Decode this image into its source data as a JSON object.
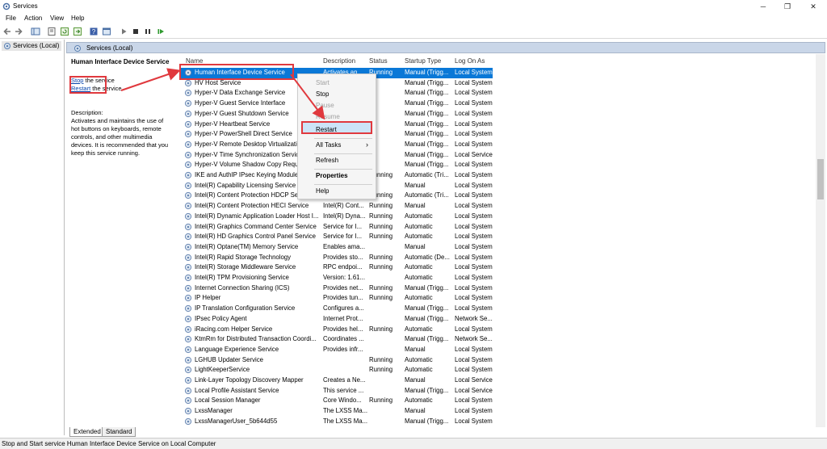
{
  "window": {
    "title": "Services",
    "minimize": "─",
    "maximize": "❐",
    "close": "✕"
  },
  "menu": [
    "File",
    "Action",
    "View",
    "Help"
  ],
  "tree": {
    "root": "Services (Local)"
  },
  "main_header": "Services (Local)",
  "description": {
    "service_name": "Human Interface Device Service",
    "stop_link": "Stop",
    "stop_suffix": " the service",
    "restart_link": "Restart",
    "restart_suffix": " the service",
    "label": "Description:",
    "lines": [
      "Activates and maintains the use of",
      "hot buttons on keyboards, remote",
      "controls, and other multimedia",
      "devices. It is recommended that you",
      "keep this service running."
    ]
  },
  "columns": {
    "name": "Name",
    "description": "Description",
    "status": "Status",
    "startup": "Startup Type",
    "logon": "Log On As"
  },
  "services": [
    {
      "name": "Human Interface Device Service",
      "desc": "Activates an...",
      "status": "Running",
      "startup": "Manual (Trigg...",
      "logon": "Local System"
    },
    {
      "name": "HV Host Service",
      "desc": "",
      "status": "",
      "startup": "Manual (Trigg...",
      "logon": "Local System"
    },
    {
      "name": "Hyper-V Data Exchange Service",
      "desc": "",
      "status": "",
      "startup": "Manual (Trigg...",
      "logon": "Local System"
    },
    {
      "name": "Hyper-V Guest Service Interface",
      "desc": "",
      "status": "",
      "startup": "Manual (Trigg...",
      "logon": "Local System"
    },
    {
      "name": "Hyper-V Guest Shutdown Service",
      "desc": "",
      "status": "",
      "startup": "Manual (Trigg...",
      "logon": "Local System"
    },
    {
      "name": "Hyper-V Heartbeat Service",
      "desc": "",
      "status": "",
      "startup": "Manual (Trigg...",
      "logon": "Local System"
    },
    {
      "name": "Hyper-V PowerShell Direct Service",
      "desc": "",
      "status": "",
      "startup": "Manual (Trigg...",
      "logon": "Local System"
    },
    {
      "name": "Hyper-V Remote Desktop Virtualizati...",
      "desc": "",
      "status": "",
      "startup": "Manual (Trigg...",
      "logon": "Local System"
    },
    {
      "name": "Hyper-V Time Synchronization Servic...",
      "desc": "",
      "status": "",
      "startup": "Manual (Trigg...",
      "logon": "Local Service"
    },
    {
      "name": "Hyper-V Volume Shadow Copy Reque...",
      "desc": "",
      "status": "",
      "startup": "Manual (Trigg...",
      "logon": "Local System"
    },
    {
      "name": "IKE and AuthIP IPsec Keying Modules",
      "desc": "",
      "status": "Running",
      "startup": "Automatic (Tri...",
      "logon": "Local System"
    },
    {
      "name": "Intel(R) Capability Licensing Service T...",
      "desc": "",
      "status": "",
      "startup": "Manual",
      "logon": "Local System"
    },
    {
      "name": "Intel(R) Content Protection HDCP Serv...",
      "desc": "",
      "status": "Running",
      "startup": "Automatic (Tri...",
      "logon": "Local System"
    },
    {
      "name": "Intel(R) Content Protection HECI Service",
      "desc": "Intel(R) Cont...",
      "status": "Running",
      "startup": "Manual",
      "logon": "Local System"
    },
    {
      "name": "Intel(R) Dynamic Application Loader Host I...",
      "desc": "Intel(R) Dyna...",
      "status": "Running",
      "startup": "Automatic",
      "logon": "Local System"
    },
    {
      "name": "Intel(R) Graphics Command Center Service",
      "desc": "Service for I...",
      "status": "Running",
      "startup": "Automatic",
      "logon": "Local System"
    },
    {
      "name": "Intel(R) HD Graphics Control Panel Service",
      "desc": "Service for I...",
      "status": "Running",
      "startup": "Automatic",
      "logon": "Local System"
    },
    {
      "name": "Intel(R) Optane(TM) Memory Service",
      "desc": "Enables ama...",
      "status": "",
      "startup": "Manual",
      "logon": "Local System"
    },
    {
      "name": "Intel(R) Rapid Storage Technology",
      "desc": "Provides sto...",
      "status": "Running",
      "startup": "Automatic (De...",
      "logon": "Local System"
    },
    {
      "name": "Intel(R) Storage Middleware Service",
      "desc": "RPC endpoi...",
      "status": "Running",
      "startup": "Automatic",
      "logon": "Local System"
    },
    {
      "name": "Intel(R) TPM Provisioning Service",
      "desc": "Version: 1.61...",
      "status": "",
      "startup": "Automatic",
      "logon": "Local System"
    },
    {
      "name": "Internet Connection Sharing (ICS)",
      "desc": "Provides net...",
      "status": "Running",
      "startup": "Manual (Trigg...",
      "logon": "Local System"
    },
    {
      "name": "IP Helper",
      "desc": "Provides tun...",
      "status": "Running",
      "startup": "Automatic",
      "logon": "Local System"
    },
    {
      "name": "IP Translation Configuration Service",
      "desc": "Configures a...",
      "status": "",
      "startup": "Manual (Trigg...",
      "logon": "Local System"
    },
    {
      "name": "IPsec Policy Agent",
      "desc": "Internet Prot...",
      "status": "",
      "startup": "Manual (Trigg...",
      "logon": "Network Se..."
    },
    {
      "name": "iRacing.com Helper Service",
      "desc": "Provides hel...",
      "status": "Running",
      "startup": "Automatic",
      "logon": "Local System"
    },
    {
      "name": "KtmRm for Distributed Transaction Coordi...",
      "desc": "Coordinates ...",
      "status": "",
      "startup": "Manual (Trigg...",
      "logon": "Network Se..."
    },
    {
      "name": "Language Experience Service",
      "desc": "Provides infr...",
      "status": "",
      "startup": "Manual",
      "logon": "Local System"
    },
    {
      "name": "LGHUB Updater Service",
      "desc": "",
      "status": "Running",
      "startup": "Automatic",
      "logon": "Local System"
    },
    {
      "name": "LightKeeperService",
      "desc": "",
      "status": "Running",
      "startup": "Automatic",
      "logon": "Local System"
    },
    {
      "name": "Link-Layer Topology Discovery Mapper",
      "desc": "Creates a Ne...",
      "status": "",
      "startup": "Manual",
      "logon": "Local Service"
    },
    {
      "name": "Local Profile Assistant Service",
      "desc": "This service ...",
      "status": "",
      "startup": "Manual (Trigg...",
      "logon": "Local Service"
    },
    {
      "name": "Local Session Manager",
      "desc": "Core Windo...",
      "status": "Running",
      "startup": "Automatic",
      "logon": "Local System"
    },
    {
      "name": "LxssManager",
      "desc": "The LXSS Ma...",
      "status": "",
      "startup": "Manual",
      "logon": "Local System"
    },
    {
      "name": "LxssManagerUser_5b644d55",
      "desc": "The LXSS Ma...",
      "status": "",
      "startup": "Manual (Trigg...",
      "logon": "Local System"
    }
  ],
  "context_menu": {
    "start": "Start",
    "stop": "Stop",
    "pause": "Pause",
    "resume": "Resume",
    "restart": "Restart",
    "all_tasks": "All Tasks",
    "refresh": "Refresh",
    "properties": "Properties",
    "help": "Help",
    "submenu_arrow": "›"
  },
  "tabs": [
    "Extended",
    "Standard"
  ],
  "status_text": "Stop and Start service Human Interface Device Service on Local Computer",
  "colors": {
    "selection": "#0a78d7",
    "annotation_red": "#e0393e",
    "header_blue": "#c9d6e8"
  },
  "icons": [
    "services-app-icon",
    "back-icon",
    "forward-icon",
    "console-tree-icon",
    "properties-icon",
    "refresh-icon",
    "export-icon",
    "help-icon",
    "mmc-icon",
    "play-icon",
    "stop-icon",
    "pause-icon",
    "restart-icon",
    "gear-icon"
  ]
}
